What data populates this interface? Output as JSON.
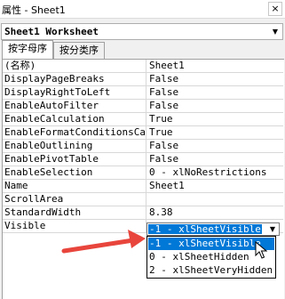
{
  "window": {
    "title": "属性 - Sheet1",
    "close_label": "×"
  },
  "object_selector": {
    "value": "Sheet1 Worksheet",
    "arrow_icon": "chevron-down-icon"
  },
  "tabs": [
    {
      "label": "按字母序"
    },
    {
      "label": "按分类序"
    }
  ],
  "properties": [
    {
      "name": "(名称)",
      "value": "Sheet1"
    },
    {
      "name": "DisplayPageBreaks",
      "value": "False"
    },
    {
      "name": "DisplayRightToLeft",
      "value": "False"
    },
    {
      "name": "EnableAutoFilter",
      "value": "False"
    },
    {
      "name": "EnableCalculation",
      "value": "True"
    },
    {
      "name": "EnableFormatConditionsCalcu",
      "value": "True"
    },
    {
      "name": "EnableOutlining",
      "value": "False"
    },
    {
      "name": "EnablePivotTable",
      "value": "False"
    },
    {
      "name": "EnableSelection",
      "value": "0 - xlNoRestrictions"
    },
    {
      "name": "Name",
      "value": "Sheet1"
    },
    {
      "name": "ScrollArea",
      "value": ""
    },
    {
      "name": "StandardWidth",
      "value": "8.38"
    },
    {
      "name": "Visible",
      "value": ""
    }
  ],
  "visible_combo": {
    "selected": "-1 - xlSheetVisible"
  },
  "dropdown_options": [
    {
      "label": "-1 - xlSheetVisible",
      "highlighted": true
    },
    {
      "label": "0 - xlSheetHidden",
      "highlighted": false
    },
    {
      "label": "2 - xlSheetVeryHidden",
      "highlighted": false
    }
  ],
  "colors": {
    "selection": "#0078d7",
    "annotation_arrow": "#e8453c"
  }
}
